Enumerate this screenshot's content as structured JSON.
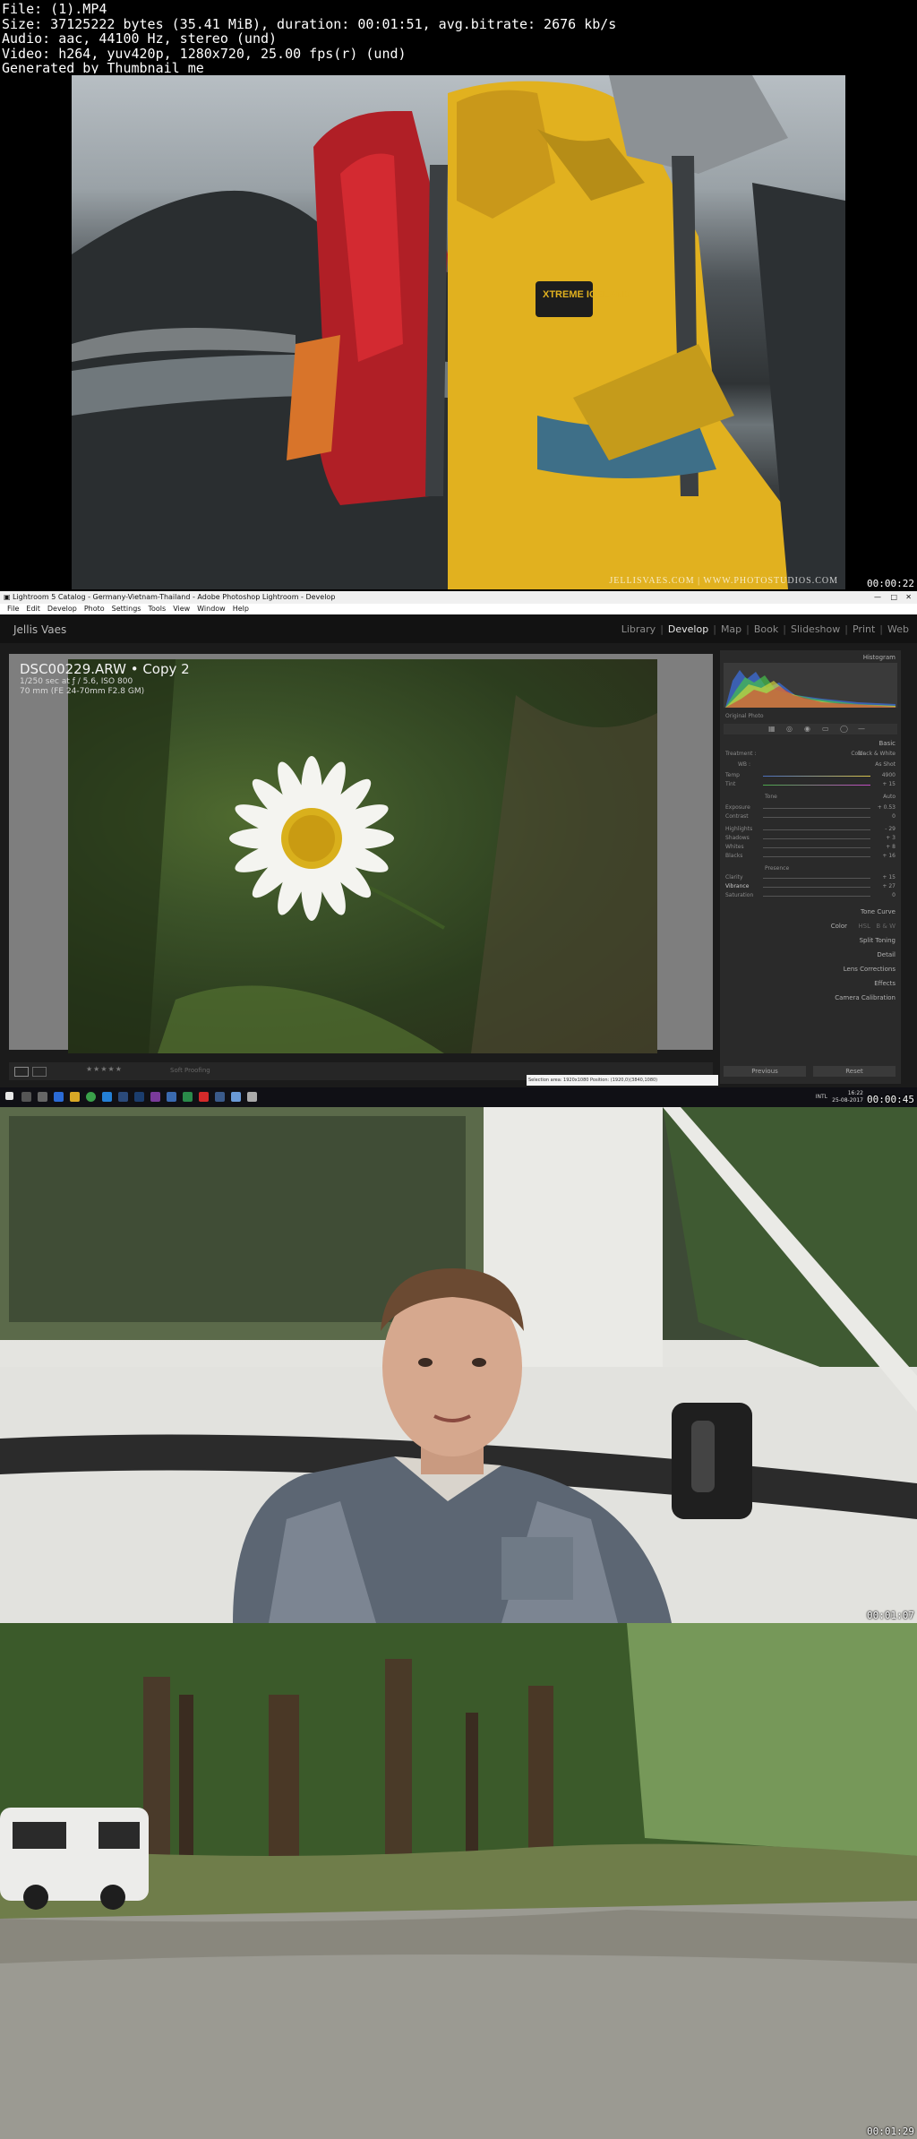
{
  "header": {
    "lines": [
      "File:  (1).MP4",
      "Size: 37125222 bytes (35.41 MiB), duration: 00:01:51, avg.bitrate: 2676 kb/s",
      "Audio: aac, 44100 Hz, stereo (und)",
      "Video: h264, yuv420p, 1280x720, 25.00 fps(r) (und)",
      "Generated by Thumbnail me"
    ]
  },
  "frames": [
    {
      "timestamp": "00:00:22",
      "watermark": "JELLISVAES.COM | WWW.PHOTOSTUDIOS.COM",
      "badge": "XTREME ICELAND"
    },
    {
      "timestamp": "00:00:45"
    },
    {
      "timestamp": "00:01:07"
    },
    {
      "timestamp": "00:01:29"
    }
  ],
  "lightroom": {
    "window_title": "Lightroom 5 Catalog - Germany-Vietnam-Thailand - Adobe Photoshop Lightroom - Develop",
    "menu": [
      "File",
      "Edit",
      "Develop",
      "Photo",
      "Settings",
      "Tools",
      "View",
      "Window",
      "Help"
    ],
    "user": "Jellis Vaes",
    "modules": [
      "Library",
      "Develop",
      "Map",
      "Book",
      "Slideshow",
      "Print",
      "Web"
    ],
    "active_module": "Develop",
    "photo_info": {
      "filename": "DSC00229.ARW  •  Copy 2",
      "exposure": "1/250 sec at ƒ / 5.6, ISO 800",
      "lens": "70 mm (FE 24-70mm F2.8 GM)"
    },
    "panels": {
      "histogram": "Histogram",
      "original_photo": "Original Photo",
      "basic": "Basic",
      "treatment": "Treatment :",
      "color": "Color",
      "bw": "Black & White",
      "wb_label": "WB :",
      "wb_value": "As Shot",
      "tone": "Tone",
      "auto": "Auto",
      "presence": "Presence",
      "sliders": [
        {
          "label": "Temp",
          "value": "4900"
        },
        {
          "label": "Tint",
          "value": "+ 15"
        },
        {
          "label": "Exposure",
          "value": "+ 0.53"
        },
        {
          "label": "Contrast",
          "value": "0"
        },
        {
          "label": "Highlights",
          "value": "- 29"
        },
        {
          "label": "Shadows",
          "value": "+ 3"
        },
        {
          "label": "Whites",
          "value": "+ 8"
        },
        {
          "label": "Blacks",
          "value": "+ 16"
        },
        {
          "label": "Clarity",
          "value": "+ 15"
        },
        {
          "label": "Vibrance",
          "value": "+ 27"
        },
        {
          "label": "Saturation",
          "value": "0"
        }
      ],
      "collapsed": [
        "Tone Curve",
        "Color",
        "Split Toning",
        "Detail",
        "Lens Corrections",
        "Effects",
        "Camera Calibration"
      ],
      "hsl": "HSL",
      "bw_short": "B & W"
    },
    "buttons": {
      "previous": "Previous",
      "reset": "Reset"
    },
    "toolbar": {
      "soft_proofing": "Soft Proofing"
    },
    "tooltip": "Selection area: 1920x1080 Position: (1920,0)(3840,1080)",
    "clock": {
      "time": "16:22",
      "date": "25-08-2017",
      "lang": "INTL"
    }
  },
  "colors": {
    "jacket": "#e1b11f",
    "backpack": "#c4222a",
    "lr_bg": "#1b1b1b",
    "lr_panel": "#2a2a2a",
    "daisy_center": "#d9b01c"
  }
}
